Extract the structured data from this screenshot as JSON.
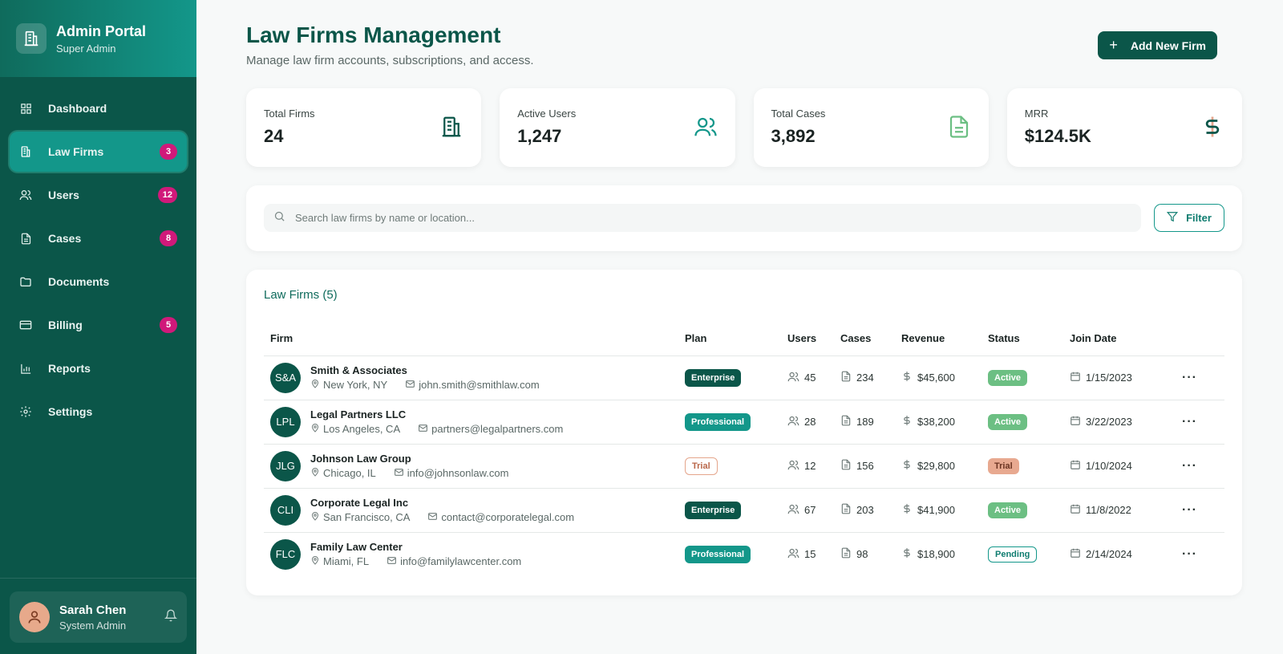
{
  "sidebar": {
    "title": "Admin Portal",
    "subtitle": "Super Admin",
    "items": [
      {
        "label": "Dashboard",
        "icon": "grid-icon",
        "badge": ""
      },
      {
        "label": "Law Firms",
        "icon": "building-icon",
        "badge": "3"
      },
      {
        "label": "Users",
        "icon": "users-icon",
        "badge": "12"
      },
      {
        "label": "Cases",
        "icon": "file-icon",
        "badge": "8"
      },
      {
        "label": "Documents",
        "icon": "folder-icon",
        "badge": ""
      },
      {
        "label": "Billing",
        "icon": "credit-card-icon",
        "badge": "5"
      },
      {
        "label": "Reports",
        "icon": "bar-chart-icon",
        "badge": ""
      },
      {
        "label": "Settings",
        "icon": "gear-icon",
        "badge": ""
      }
    ],
    "user": {
      "name": "Sarah Chen",
      "role": "System Admin"
    }
  },
  "header": {
    "title": "Law Firms Management",
    "subtitle": "Manage law firm accounts, subscriptions, and access.",
    "add_label": "Add New Firm"
  },
  "stats": [
    {
      "label": "Total Firms",
      "value": "24",
      "icon": "building-icon"
    },
    {
      "label": "Active Users",
      "value": "1,247",
      "icon": "users-icon"
    },
    {
      "label": "Total Cases",
      "value": "3,892",
      "icon": "file-text-icon"
    },
    {
      "label": "MRR",
      "value": "$124.5K",
      "icon": "dollar-icon"
    }
  ],
  "search": {
    "placeholder": "Search law firms by name or location...",
    "filter_label": "Filter"
  },
  "table": {
    "title": "Law Firms (5)",
    "columns": [
      "Firm",
      "Plan",
      "Users",
      "Cases",
      "Revenue",
      "Status",
      "Join Date"
    ],
    "rows": [
      {
        "initials": "S&A",
        "name": "Smith & Associates",
        "location": "New York, NY",
        "email": "john.smith@smithlaw.com",
        "plan": "Enterprise",
        "plan_type": "enterprise",
        "users": "45",
        "cases": "234",
        "revenue": "$45,600",
        "status": "Active",
        "status_type": "active",
        "join": "1/15/2023"
      },
      {
        "initials": "LPL",
        "name": "Legal Partners LLC",
        "location": "Los Angeles, CA",
        "email": "partners@legalpartners.com",
        "plan": "Professional",
        "plan_type": "professional",
        "users": "28",
        "cases": "189",
        "revenue": "$38,200",
        "status": "Active",
        "status_type": "active",
        "join": "3/22/2023"
      },
      {
        "initials": "JLG",
        "name": "Johnson Law Group",
        "location": "Chicago, IL",
        "email": "info@johnsonlaw.com",
        "plan": "Trial",
        "plan_type": "trial",
        "users": "12",
        "cases": "156",
        "revenue": "$29,800",
        "status": "Trial",
        "status_type": "trial",
        "join": "1/10/2024"
      },
      {
        "initials": "CLI",
        "name": "Corporate Legal Inc",
        "location": "San Francisco, CA",
        "email": "contact@corporatelegal.com",
        "plan": "Enterprise",
        "plan_type": "enterprise",
        "users": "67",
        "cases": "203",
        "revenue": "$41,900",
        "status": "Active",
        "status_type": "active",
        "join": "11/8/2022"
      },
      {
        "initials": "FLC",
        "name": "Family Law Center",
        "location": "Miami, FL",
        "email": "info@familylawcenter.com",
        "plan": "Professional",
        "plan_type": "professional",
        "users": "15",
        "cases": "98",
        "revenue": "$18,900",
        "status": "Pending",
        "status_type": "pending",
        "join": "2/14/2024"
      }
    ]
  },
  "colors": {
    "primary": "#0b5649",
    "accent": "#13978a",
    "badge": "#d0197a"
  }
}
